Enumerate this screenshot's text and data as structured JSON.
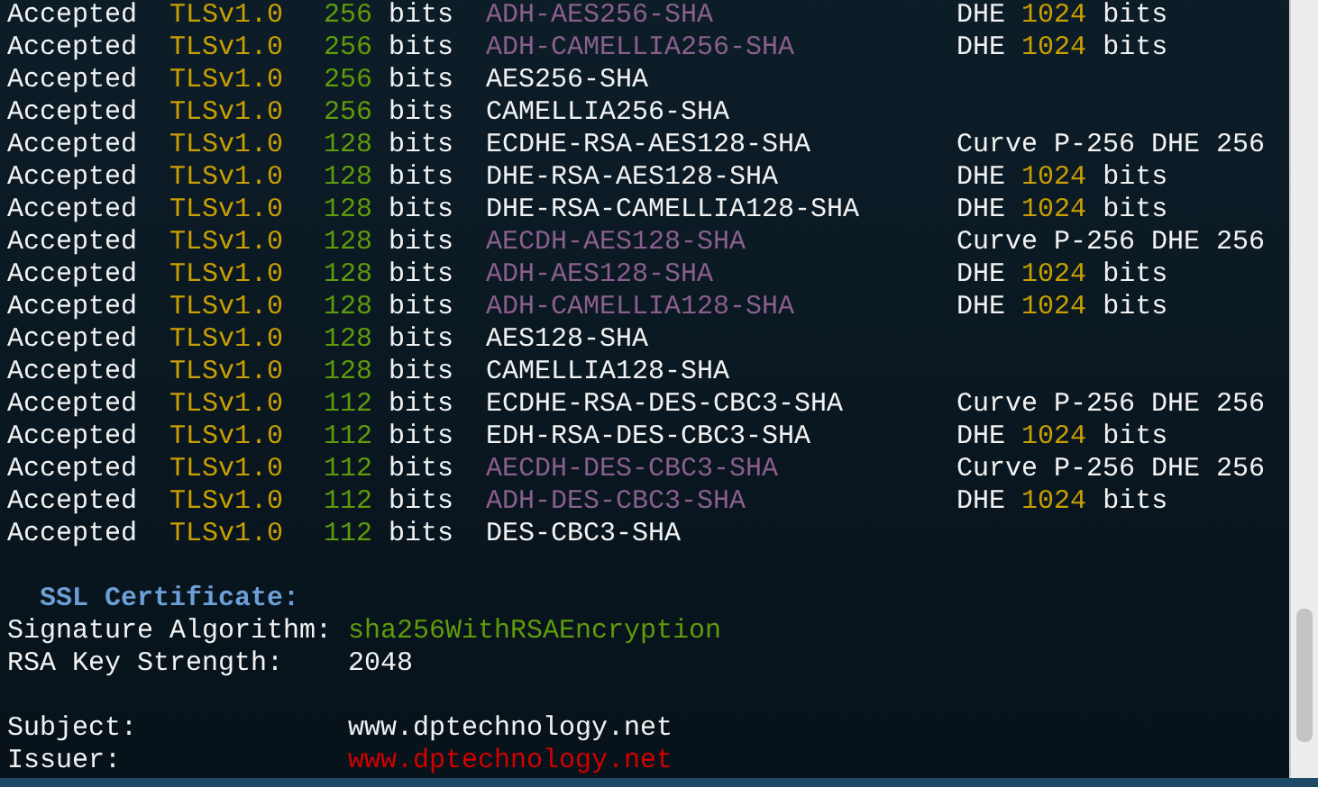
{
  "ciphers": [
    {
      "status": "Accepted",
      "protocol": "TLSv1.0",
      "bits": "256",
      "unit": "bits",
      "cipher": "ADH-AES256-SHA",
      "anonymous": true,
      "key_exchange": {
        "kind": "dhe",
        "label": "DHE",
        "size": "1024",
        "unit": "bits"
      }
    },
    {
      "status": "Accepted",
      "protocol": "TLSv1.0",
      "bits": "256",
      "unit": "bits",
      "cipher": "ADH-CAMELLIA256-SHA",
      "anonymous": true,
      "key_exchange": {
        "kind": "dhe",
        "label": "DHE",
        "size": "1024",
        "unit": "bits"
      }
    },
    {
      "status": "Accepted",
      "protocol": "TLSv1.0",
      "bits": "256",
      "unit": "bits",
      "cipher": "AES256-SHA",
      "anonymous": false
    },
    {
      "status": "Accepted",
      "protocol": "TLSv1.0",
      "bits": "256",
      "unit": "bits",
      "cipher": "CAMELLIA256-SHA",
      "anonymous": false
    },
    {
      "status": "Accepted",
      "protocol": "TLSv1.0",
      "bits": "128",
      "unit": "bits",
      "cipher": "ECDHE-RSA-AES128-SHA",
      "anonymous": false,
      "key_exchange": {
        "kind": "curve",
        "label": "Curve P-256 DHE 256"
      }
    },
    {
      "status": "Accepted",
      "protocol": "TLSv1.0",
      "bits": "128",
      "unit": "bits",
      "cipher": "DHE-RSA-AES128-SHA",
      "anonymous": false,
      "key_exchange": {
        "kind": "dhe",
        "label": "DHE",
        "size": "1024",
        "unit": "bits"
      }
    },
    {
      "status": "Accepted",
      "protocol": "TLSv1.0",
      "bits": "128",
      "unit": "bits",
      "cipher": "DHE-RSA-CAMELLIA128-SHA",
      "anonymous": false,
      "key_exchange": {
        "kind": "dhe",
        "label": "DHE",
        "size": "1024",
        "unit": "bits"
      }
    },
    {
      "status": "Accepted",
      "protocol": "TLSv1.0",
      "bits": "128",
      "unit": "bits",
      "cipher": "AECDH-AES128-SHA",
      "anonymous": true,
      "key_exchange": {
        "kind": "curve",
        "label": "Curve P-256 DHE 256"
      }
    },
    {
      "status": "Accepted",
      "protocol": "TLSv1.0",
      "bits": "128",
      "unit": "bits",
      "cipher": "ADH-AES128-SHA",
      "anonymous": true,
      "key_exchange": {
        "kind": "dhe",
        "label": "DHE",
        "size": "1024",
        "unit": "bits"
      }
    },
    {
      "status": "Accepted",
      "protocol": "TLSv1.0",
      "bits": "128",
      "unit": "bits",
      "cipher": "ADH-CAMELLIA128-SHA",
      "anonymous": true,
      "key_exchange": {
        "kind": "dhe",
        "label": "DHE",
        "size": "1024",
        "unit": "bits"
      }
    },
    {
      "status": "Accepted",
      "protocol": "TLSv1.0",
      "bits": "128",
      "unit": "bits",
      "cipher": "AES128-SHA",
      "anonymous": false
    },
    {
      "status": "Accepted",
      "protocol": "TLSv1.0",
      "bits": "128",
      "unit": "bits",
      "cipher": "CAMELLIA128-SHA",
      "anonymous": false
    },
    {
      "status": "Accepted",
      "protocol": "TLSv1.0",
      "bits": "112",
      "unit": "bits",
      "cipher": "ECDHE-RSA-DES-CBC3-SHA",
      "anonymous": false,
      "key_exchange": {
        "kind": "curve",
        "label": "Curve P-256 DHE 256"
      }
    },
    {
      "status": "Accepted",
      "protocol": "TLSv1.0",
      "bits": "112",
      "unit": "bits",
      "cipher": "EDH-RSA-DES-CBC3-SHA",
      "anonymous": false,
      "key_exchange": {
        "kind": "dhe",
        "label": "DHE",
        "size": "1024",
        "unit": "bits"
      }
    },
    {
      "status": "Accepted",
      "protocol": "TLSv1.0",
      "bits": "112",
      "unit": "bits",
      "cipher": "AECDH-DES-CBC3-SHA",
      "anonymous": true,
      "key_exchange": {
        "kind": "curve",
        "label": "Curve P-256 DHE 256"
      }
    },
    {
      "status": "Accepted",
      "protocol": "TLSv1.0",
      "bits": "112",
      "unit": "bits",
      "cipher": "ADH-DES-CBC3-SHA",
      "anonymous": true,
      "key_exchange": {
        "kind": "dhe",
        "label": "DHE",
        "size": "1024",
        "unit": "bits"
      }
    },
    {
      "status": "Accepted",
      "protocol": "TLSv1.0",
      "bits": "112",
      "unit": "bits",
      "cipher": "DES-CBC3-SHA",
      "anonymous": false
    }
  ],
  "certificate": {
    "heading": "SSL Certificate:",
    "fields": [
      {
        "label": "Signature Algorithm:",
        "value": "sha256WithRSAEncryption",
        "kind": "algorithm"
      },
      {
        "label": "RSA Key Strength:",
        "value": "2048",
        "kind": "plain"
      },
      {
        "kind": "gap"
      },
      {
        "label": "Subject:",
        "value": "www.dptechnology.net",
        "kind": "plain"
      },
      {
        "label": "Issuer:",
        "value": "www.dptechnology.net",
        "kind": "issuer"
      }
    ]
  }
}
